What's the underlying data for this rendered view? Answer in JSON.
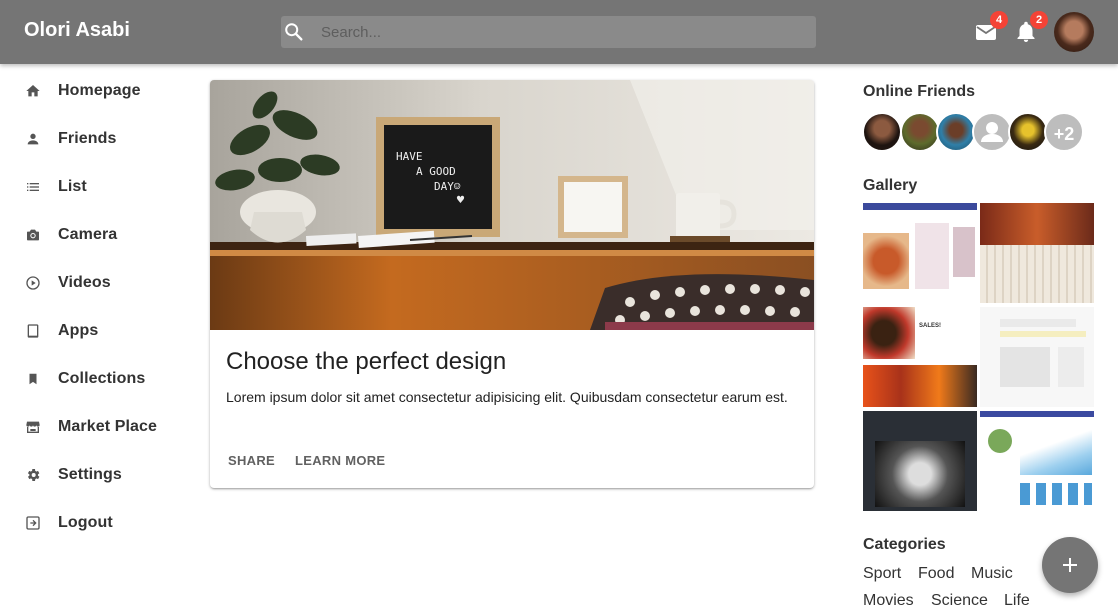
{
  "app": {
    "title": "Olori Asabi"
  },
  "search": {
    "placeholder": "Search..."
  },
  "header": {
    "mail": {
      "icon": "mail-icon",
      "count": "4"
    },
    "notifications": {
      "icon": "bell-icon",
      "count": "2"
    }
  },
  "sidebar": {
    "items": [
      {
        "label": "Homepage",
        "icon": "home-icon"
      },
      {
        "label": "Friends",
        "icon": "person-icon"
      },
      {
        "label": "List",
        "icon": "list-icon"
      },
      {
        "label": "Camera",
        "icon": "camera-icon"
      },
      {
        "label": "Videos",
        "icon": "play-circle-icon"
      },
      {
        "label": "Apps",
        "icon": "tablet-icon"
      },
      {
        "label": "Collections",
        "icon": "bookmark-icon"
      },
      {
        "label": "Market Place",
        "icon": "store-icon"
      },
      {
        "label": "Settings",
        "icon": "gear-icon"
      },
      {
        "label": "Logout",
        "icon": "exit-icon"
      }
    ]
  },
  "card": {
    "title": "Choose the perfect design",
    "body": "Lorem ipsum dolor sit amet consectetur adipisicing elit. Quibusdam consectetur earum est.",
    "letterboard": {
      "line1": "HAVE",
      "line2": "A GOOD",
      "line3": "DAY☺",
      "line4": "♥"
    },
    "actions": {
      "share": "SHARE",
      "learn_more": "LEARN MORE"
    }
  },
  "online_friends": {
    "heading": "Online Friends",
    "more": "+2"
  },
  "gallery": {
    "heading": "Gallery",
    "thumb4_text": "SALES!"
  },
  "categories": {
    "heading": "Categories",
    "items": [
      "Sport",
      "Food",
      "Music",
      "Movies",
      "Science",
      "Life"
    ]
  },
  "colors": {
    "appbar": "#757575",
    "badge": "#f44336",
    "fab": "#757575"
  }
}
